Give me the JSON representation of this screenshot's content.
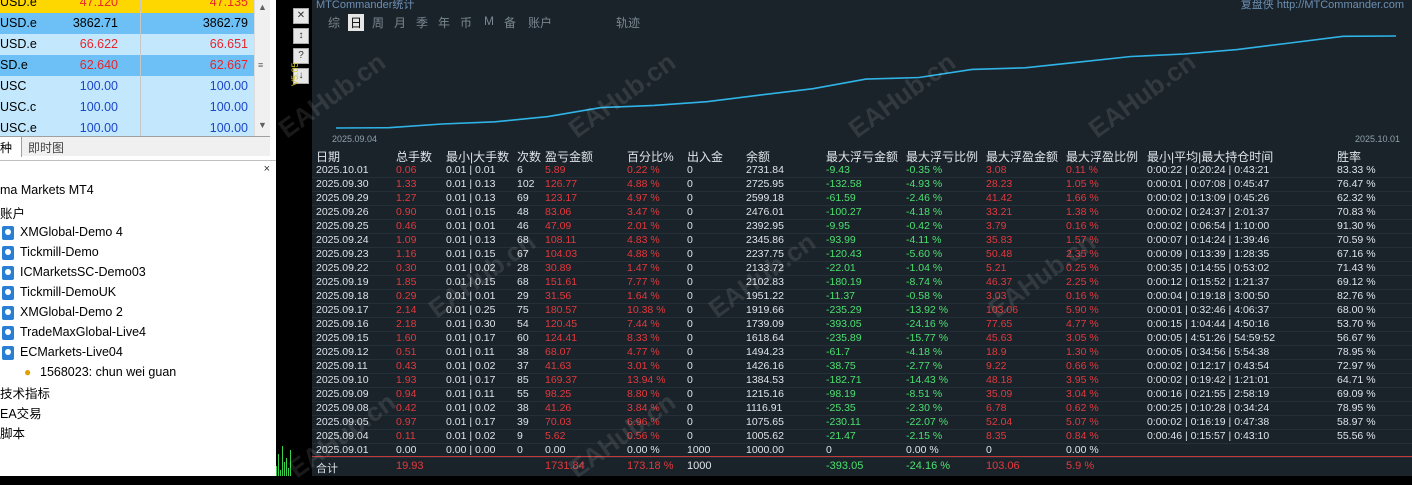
{
  "market_watch": {
    "rows": [
      {
        "symbol": "USD.e",
        "bid": "47.120",
        "ask": "47.135",
        "bg": "#ffd700",
        "bidColor": "#e8242b",
        "askColor": "#e8242b"
      },
      {
        "symbol": "USD.e",
        "bid": "3862.71",
        "ask": "3862.79",
        "bg": "#6cc0f5",
        "bidColor": "#000000",
        "askColor": "#000000"
      },
      {
        "symbol": "USD.e",
        "bid": "66.622",
        "ask": "66.651",
        "bg": "#c3e8fd",
        "bidColor": "#e8242b",
        "askColor": "#e8242b"
      },
      {
        "symbol": "SD.e",
        "bid": "62.640",
        "ask": "62.667",
        "bg": "#6cc0f5",
        "bidColor": "#e8242b",
        "askColor": "#e8242b"
      },
      {
        "symbol": "USC",
        "bid": "100.00",
        "ask": "100.00",
        "bg": "#c3e8fd",
        "bidColor": "#1a46c8",
        "askColor": "#1a46c8"
      },
      {
        "symbol": "USC.c",
        "bid": "100.00",
        "ask": "100.00",
        "bg": "#c3e8fd",
        "bidColor": "#1a46c8",
        "askColor": "#1a46c8"
      },
      {
        "symbol": "USC.e",
        "bid": "100.00",
        "ask": "100.00",
        "bg": "#c3e8fd",
        "bidColor": "#1a46c8",
        "askColor": "#1a46c8"
      }
    ],
    "tab_1": "种",
    "tab_2": "即时图"
  },
  "navigator": {
    "title": "ma Markets MT4",
    "accounts_label": "账户",
    "accounts": [
      "XMGlobal-Demo 4",
      "Tickmill-Demo",
      "ICMarketsSC-Demo03",
      "Tickmill-DemoUK",
      "XMGlobal-Demo 2",
      "TradeMaxGlobal-Live4",
      "ECMarkets-Live04"
    ],
    "sub_account": "1568023: chun wei guan",
    "tail": [
      "技术指标",
      "EA交易",
      "脚本"
    ],
    "close_glyph": "×"
  },
  "report": {
    "app_title": "MTCommander统计",
    "top_right": "复盘侠 http://MTCommander.com",
    "periods": [
      "综",
      "日",
      "周",
      "月",
      "季",
      "年",
      "币",
      "M",
      "备",
      "账户",
      "轨迹"
    ],
    "active_period": "日",
    "curve_label": "V5.05",
    "date_start": "2025.09.04",
    "date_end": "2025.10.01",
    "equity_curve": [
      1000.0,
      1005.62,
      1075.65,
      1116.91,
      1215.16,
      1384.53,
      1426.16,
      1494.23,
      1618.64,
      1739.09,
      1919.66,
      1951.22,
      2102.83,
      2133.72,
      2237.75,
      2345.86,
      2392.95,
      2476.01,
      2599.18,
      2725.95,
      2731.84
    ],
    "headers": [
      "日期",
      "总手数",
      "最小|大手数",
      "次数",
      "盈亏金额",
      "百分比%",
      "出入金",
      "余额",
      "最大浮亏金额",
      "最大浮亏比例",
      "最大浮盈金额",
      "最大浮盈比例",
      "最小|平均|最大持仓时间",
      "胜率"
    ],
    "rows": [
      [
        "2025.10.01",
        "0.06",
        "0.01 | 0.01",
        "6",
        "5.89",
        "0.22 %",
        "0",
        "2731.84",
        "-9.43",
        "-0.35 %",
        "3.08",
        "0.11 %",
        "0:00:22 | 0:20:24 | 0:43:21",
        "83.33 %"
      ],
      [
        "2025.09.30",
        "1.33",
        "0.01 | 0.13",
        "102",
        "126.77",
        "4.88 %",
        "0",
        "2725.95",
        "-132.58",
        "-4.93 %",
        "28.23",
        "1.05 %",
        "0:00:01 | 0:07:08 | 0:45:47",
        "76.47 %"
      ],
      [
        "2025.09.29",
        "1.27",
        "0.01 | 0.13",
        "69",
        "123.17",
        "4.97 %",
        "0",
        "2599.18",
        "-61.59",
        "-2.46 %",
        "41.42",
        "1.66 %",
        "0:00:02 | 0:13:09 | 0:45:26",
        "62.32 %"
      ],
      [
        "2025.09.26",
        "0.90",
        "0.01 | 0.15",
        "48",
        "83.06",
        "3.47 %",
        "0",
        "2476.01",
        "-100.27",
        "-4.18 %",
        "33.21",
        "1.38 %",
        "0:00:02 | 0:24:37 | 2:01:37",
        "70.83 %"
      ],
      [
        "2025.09.25",
        "0.46",
        "0.01 | 0.01",
        "46",
        "47.09",
        "2.01 %",
        "0",
        "2392.95",
        "-9.95",
        "-0.42 %",
        "3.79",
        "0.16 %",
        "0:00:02 | 0:06:54 | 1:10:00",
        "91.30 %"
      ],
      [
        "2025.09.24",
        "1.09",
        "0.01 | 0.13",
        "68",
        "108.11",
        "4.83 %",
        "0",
        "2345.86",
        "-93.99",
        "-4.11 %",
        "35.83",
        "1.57 %",
        "0:00:07 | 0:14:24 | 1:39:46",
        "70.59 %"
      ],
      [
        "2025.09.23",
        "1.16",
        "0.01 | 0.15",
        "67",
        "104.03",
        "4.88 %",
        "0",
        "2237.75",
        "-120.43",
        "-5.60 %",
        "50.48",
        "2.35 %",
        "0:00:09 | 0:13:39 | 1:28:35",
        "67.16 %"
      ],
      [
        "2025.09.22",
        "0.30",
        "0.01 | 0.02",
        "28",
        "30.89",
        "1.47 %",
        "0",
        "2133.72",
        "-22.01",
        "-1.04 %",
        "5.21",
        "0.25 %",
        "0:00:35 | 0:14:55 | 0:53:02",
        "71.43 %"
      ],
      [
        "2025.09.19",
        "1.85",
        "0.01 | 0.15",
        "68",
        "151.61",
        "7.77 %",
        "0",
        "2102.83",
        "-180.19",
        "-8.74 %",
        "46.37",
        "2.25 %",
        "0:00:12 | 0:15:52 | 1:21:37",
        "69.12 %"
      ],
      [
        "2025.09.18",
        "0.29",
        "0.01 | 0.01",
        "29",
        "31.56",
        "1.64 %",
        "0",
        "1951.22",
        "-11.37",
        "-0.58 %",
        "3.03",
        "0.16 %",
        "0:00:04 | 0:19:18 | 3:00:50",
        "82.76 %"
      ],
      [
        "2025.09.17",
        "2.14",
        "0.01 | 0.25",
        "75",
        "180.57",
        "10.38 %",
        "0",
        "1919.66",
        "-235.29",
        "-13.92 %",
        "103.06",
        "5.90 %",
        "0:00:01 | 0:32:46 | 4:06:37",
        "68.00 %"
      ],
      [
        "2025.09.16",
        "2.18",
        "0.01 | 0.30",
        "54",
        "120.45",
        "7.44 %",
        "0",
        "1739.09",
        "-393.05",
        "-24.16 %",
        "77.65",
        "4.77 %",
        "0:00:15 | 1:04:44 | 4:50:16",
        "53.70 %"
      ],
      [
        "2025.09.15",
        "1.60",
        "0.01 | 0.17",
        "60",
        "124.41",
        "8.33 %",
        "0",
        "1618.64",
        "-235.89",
        "-15.77 %",
        "45.63",
        "3.05 %",
        "0:00:05 | 4:51:26 | 54:59:52",
        "56.67 %"
      ],
      [
        "2025.09.12",
        "0.51",
        "0.01 | 0.11",
        "38",
        "68.07",
        "4.77 %",
        "0",
        "1494.23",
        "-61.7",
        "-4.18 %",
        "18.9",
        "1.30 %",
        "0:00:05 | 0:34:56 | 5:54:38",
        "78.95 %"
      ],
      [
        "2025.09.11",
        "0.43",
        "0.01 | 0.02",
        "37",
        "41.63",
        "3.01 %",
        "0",
        "1426.16",
        "-38.75",
        "-2.77 %",
        "9.22",
        "0.66 %",
        "0:00:02 | 0:12:17 | 0:43:54",
        "72.97 %"
      ],
      [
        "2025.09.10",
        "1.93",
        "0.01 | 0.17",
        "85",
        "169.37",
        "13.94 %",
        "0",
        "1384.53",
        "-182.71",
        "-14.43 %",
        "48.18",
        "3.95 %",
        "0:00:02 | 0:19:42 | 1:21:01",
        "64.71 %"
      ],
      [
        "2025.09.09",
        "0.94",
        "0.01 | 0.11",
        "55",
        "98.25",
        "8.80 %",
        "0",
        "1215.16",
        "-98.19",
        "-8.51 %",
        "35.09",
        "3.04 %",
        "0:00:16 | 0:21:55 | 2:58:19",
        "69.09 %"
      ],
      [
        "2025.09.08",
        "0.42",
        "0.01 | 0.02",
        "38",
        "41.26",
        "3.84 %",
        "0",
        "1116.91",
        "-25.35",
        "-2.30 %",
        "6.78",
        "0.62 %",
        "0:00:25 | 0:10:28 | 0:34:24",
        "78.95 %"
      ],
      [
        "2025.09.05",
        "0.97",
        "0.01 | 0.17",
        "39",
        "70.03",
        "6.96 %",
        "0",
        "1075.65",
        "-230.11",
        "-22.07 %",
        "52.04",
        "5.07 %",
        "0:00:02 | 0:16:19 | 0:47:38",
        "58.97 %"
      ],
      [
        "2025.09.04",
        "0.11",
        "0.01 | 0.02",
        "9",
        "5.62",
        "0.56 %",
        "0",
        "1005.62",
        "-21.47",
        "-2.15 %",
        "8.35",
        "0.84 %",
        "0:00:46 | 0:15:57 | 0:43:10",
        "55.56 %"
      ],
      [
        "2025.09.01",
        "0.00",
        "0.00 | 0.00",
        "0",
        "0.00",
        "0.00 %",
        "1000",
        "1000.00",
        "0",
        "0.00 %",
        "0",
        "0.00 %",
        "",
        ""
      ]
    ],
    "total": [
      "合计",
      "19.93",
      "",
      "",
      "1731.84",
      "173.18 %",
      "1000",
      "",
      "-393.05",
      "-24.16 %",
      "103.06",
      "5.9 %",
      "",
      ""
    ],
    "colors": {
      "positive": "#e2393d",
      "negative": "#4be06f",
      "text": "#dde4ea",
      "curve": "#2fb4e8",
      "background": "#1b232a"
    },
    "watermark": "EAHub.cn"
  }
}
